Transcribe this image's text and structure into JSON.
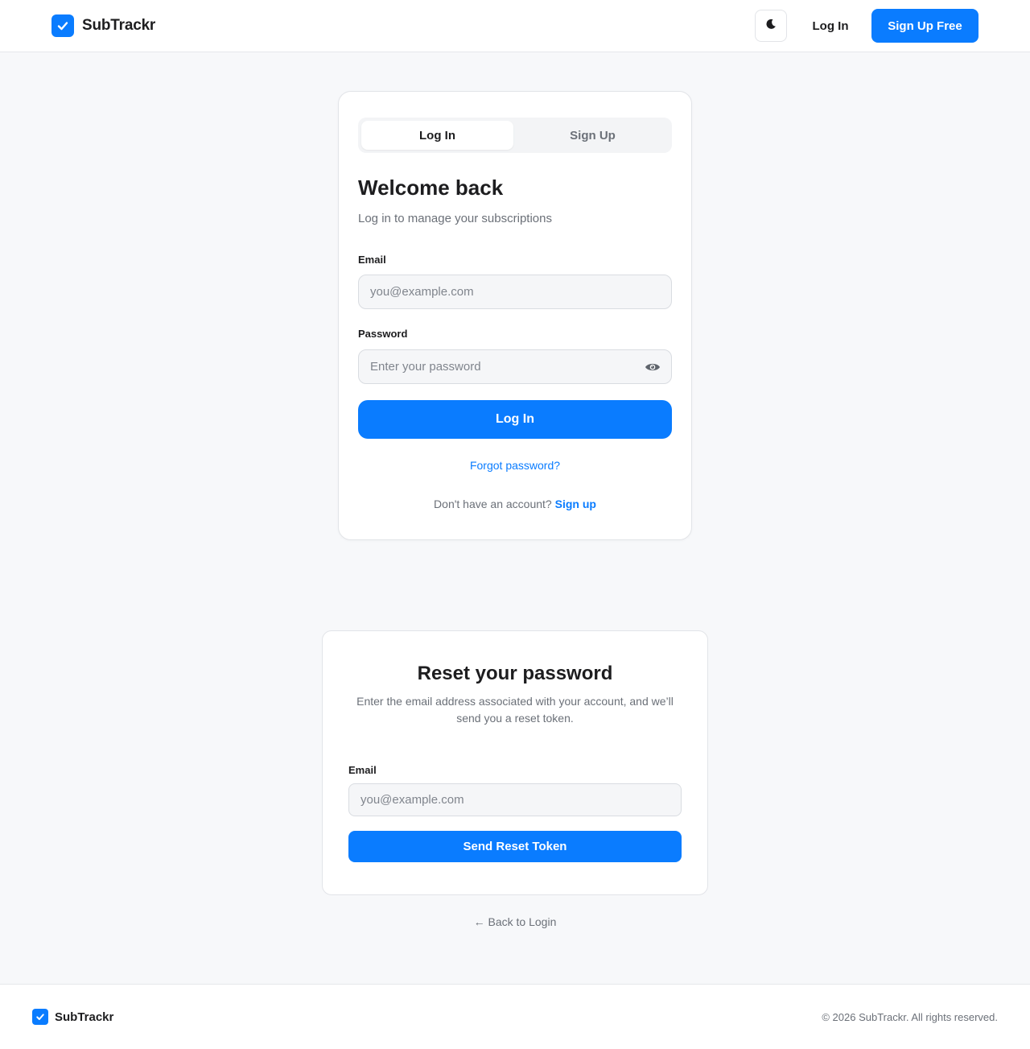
{
  "header": {
    "brand": "SubTrackr",
    "login_label": "Log In",
    "signup_label": "Sign Up Free"
  },
  "login_card": {
    "tabs": [
      {
        "label": "Log In",
        "active": true
      },
      {
        "label": "Sign Up",
        "active": false
      }
    ],
    "title": "Welcome back",
    "subtitle": "Log in to manage your subscriptions",
    "email_label": "Email",
    "email_placeholder": "you@example.com",
    "password_label": "Password",
    "password_placeholder": "Enter your password",
    "submit_label": "Log In",
    "forgot_label": "Forgot password?",
    "no_account_text": "Don't have an account?",
    "signup_link": "Sign up"
  },
  "reset_card": {
    "title": "Reset your password",
    "description": "Enter the email address associated with your account, and we’ll send you a reset token.",
    "email_label": "Email",
    "email_placeholder": "you@example.com",
    "submit_label": "Send Reset Token",
    "back_label": "← Back to Login"
  },
  "footer": {
    "brand": "SubTrackr",
    "copyright": "© 2026 SubTrackr. All rights reserved."
  },
  "colors": {
    "accent": "#0a7cff",
    "background": "#f7f8fa",
    "text": "#1d1d1f",
    "muted": "#6b7078"
  },
  "icons": {
    "logo": "check-icon",
    "theme": "moon-icon",
    "password_toggle": "eye-icon"
  }
}
